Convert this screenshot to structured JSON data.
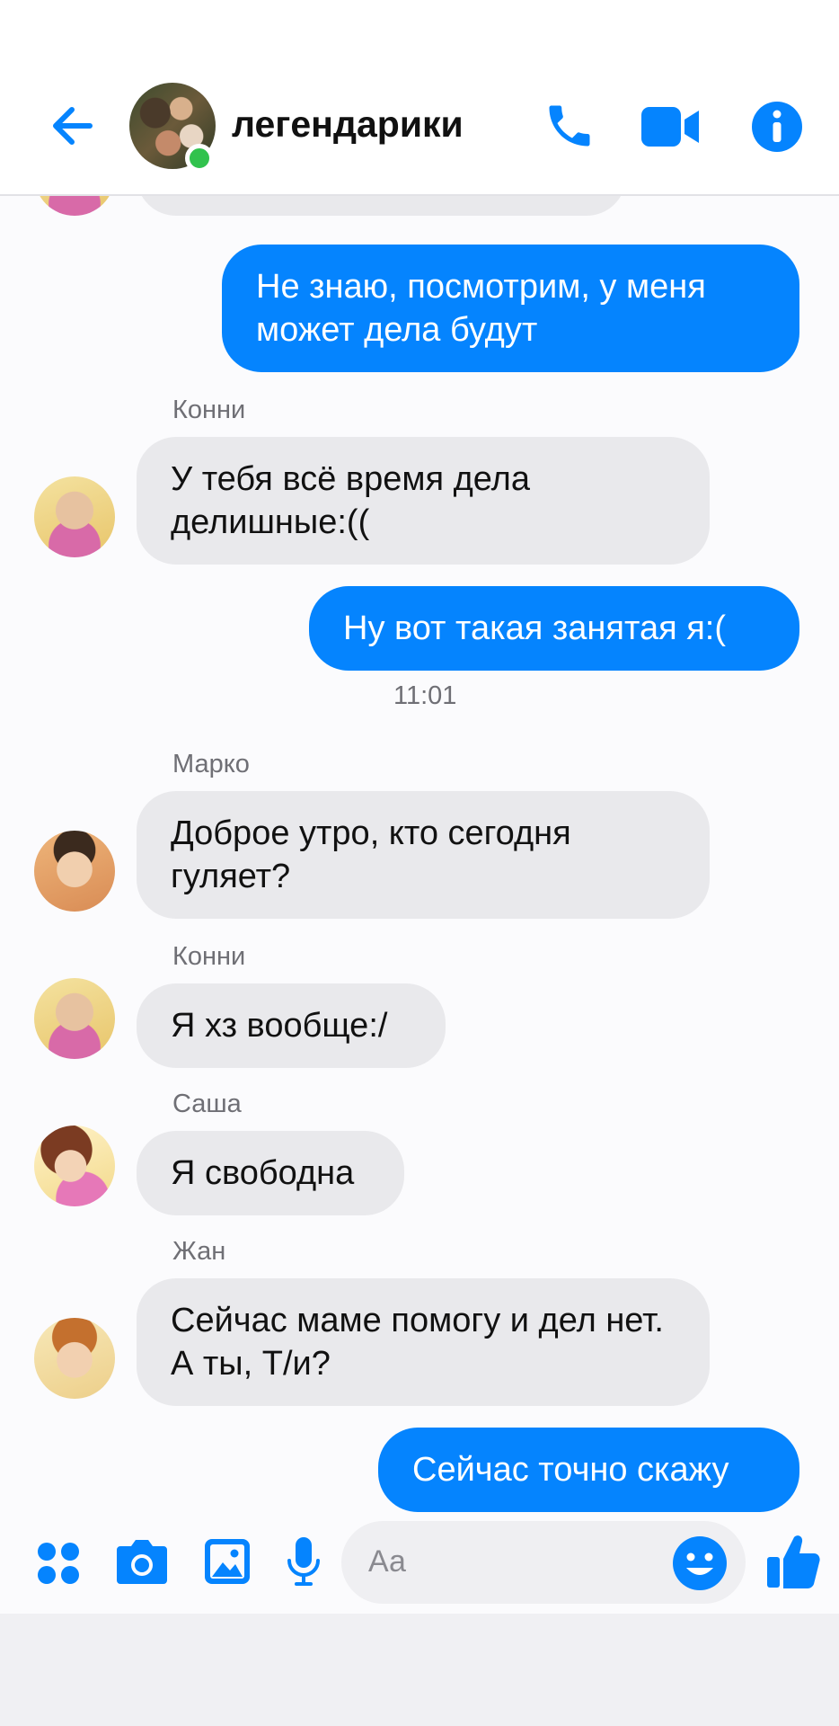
{
  "header": {
    "title": "легендарики",
    "back_icon": "arrow-left-icon",
    "call_icon": "phone-icon",
    "video_icon": "video-camera-icon",
    "info_icon": "info-icon",
    "accent": "#0584fe",
    "online_color": "#31c24d"
  },
  "messages": [
    {
      "type": "out",
      "text": "Не знаю, посмотрим, у меня может дела будут"
    },
    {
      "type": "in",
      "sender": "Конни",
      "text": "У тебя всё время дела делишные:(("
    },
    {
      "type": "out",
      "text": "Ну вот такая занятая я:("
    },
    {
      "type": "time",
      "text": "11:01"
    },
    {
      "type": "in",
      "sender": "Марко",
      "text": "Доброе утро, кто сегодня гуляет?"
    },
    {
      "type": "in",
      "sender": "Конни",
      "text": "Я хз вообще:/"
    },
    {
      "type": "in",
      "sender": "Саша",
      "text": "Я свободна"
    },
    {
      "type": "in",
      "sender": "Жан",
      "text": "Сейчас маме помогу и дел нет. А ты, Т/и?"
    },
    {
      "type": "out",
      "text": "Сейчас точно скажу"
    }
  ],
  "composer": {
    "placeholder": "Аа",
    "icons": [
      "apps-icon",
      "camera-icon",
      "gallery-icon",
      "microphone-icon",
      "emoji-icon",
      "thumbs-up-icon"
    ]
  }
}
